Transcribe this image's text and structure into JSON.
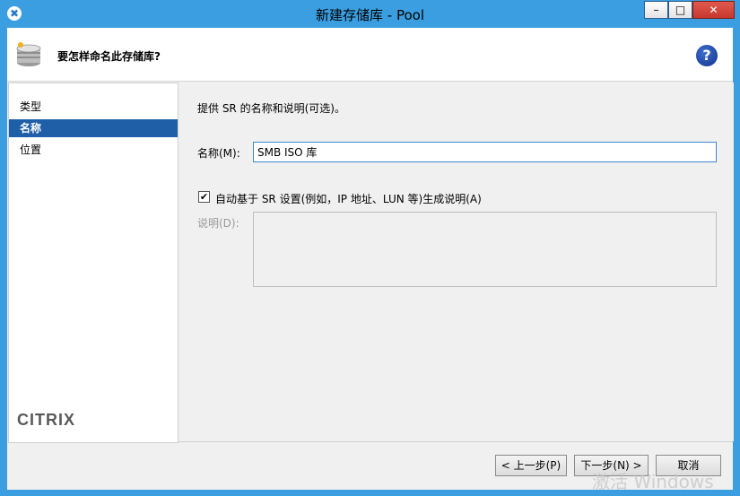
{
  "window": {
    "title": "新建存储库 - Pool",
    "minimize": "–",
    "maximize": "□",
    "close": "✕",
    "app_icon": "✖"
  },
  "header": {
    "question": "要怎样命名此存储库?",
    "help_glyph": "?"
  },
  "sidebar": {
    "items": [
      {
        "label": "类型",
        "active": false
      },
      {
        "label": "名称",
        "active": true
      },
      {
        "label": "位置",
        "active": false
      }
    ],
    "brand": "CITRIX"
  },
  "main": {
    "intro": "提供 SR 的名称和说明(可选)。",
    "name_label": "名称(M):",
    "name_value": "SMB ISO 库",
    "auto_desc_checked": true,
    "auto_desc_check_glyph": "✔",
    "auto_desc_label": "自动基于 SR 设置(例如，IP 地址、LUN 等)生成说明(A)",
    "desc_label": "说明(D):",
    "desc_value": ""
  },
  "buttons": {
    "prev": "< 上一步(P)",
    "next": "下一步(N) >",
    "cancel": "取消"
  },
  "watermark": "激活 Windows",
  "colors": {
    "frame": "#3a9ee0",
    "active_item": "#1f5fa8",
    "input_border": "#3a88d0"
  }
}
